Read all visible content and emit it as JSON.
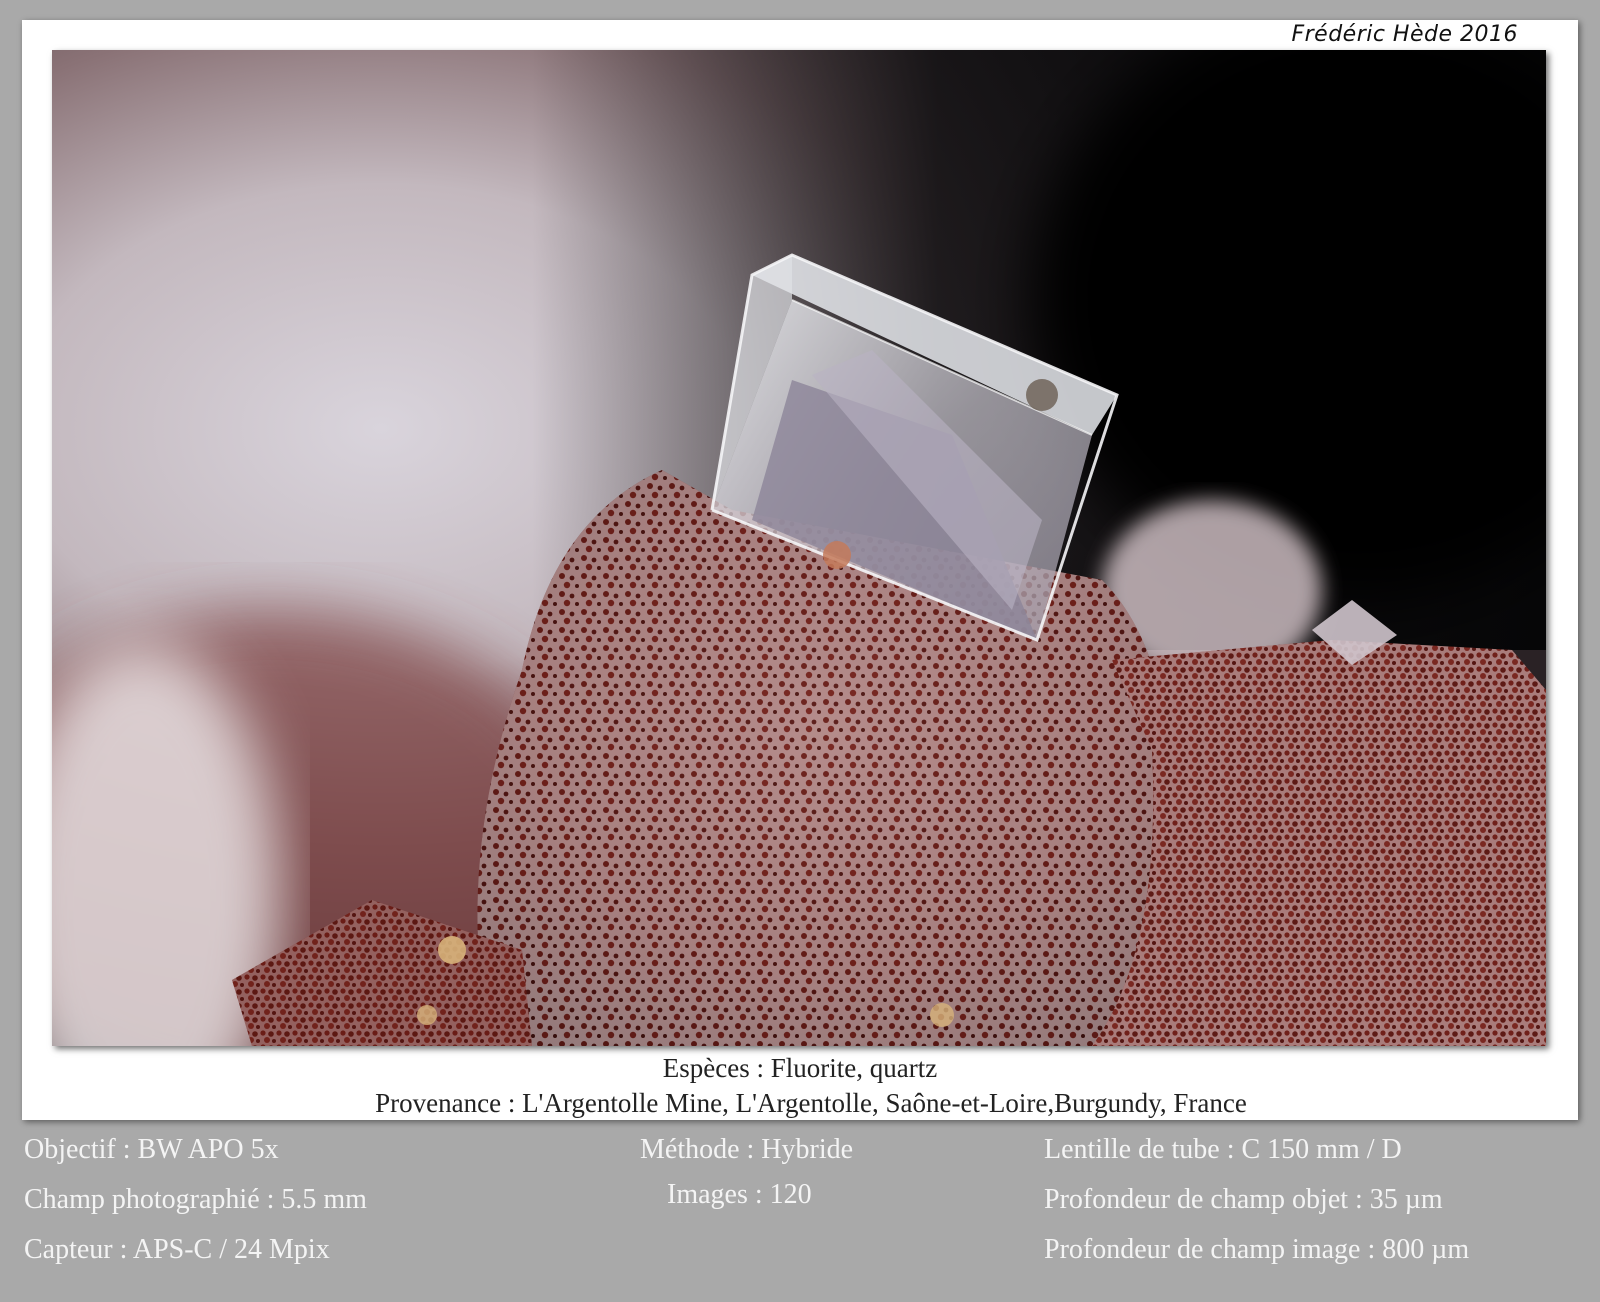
{
  "credit": "Frédéric Hède 2016",
  "caption": {
    "species": "Espèces : Fluorite, quartz",
    "provenance": "Provenance : L'Argentolle Mine, L'Argentolle, Saône-et-Loire,Burgundy, France"
  },
  "meta": {
    "left": [
      "Objectif : BW APO 5x",
      "Champ photographié : 5.5 mm",
      "Capteur : APS-C / 24 Mpix"
    ],
    "center": [
      "Méthode : Hybride",
      "Images : 120"
    ],
    "right": [
      "Lentille de tube : C 150 mm / D",
      "Profondeur de champ objet : 35 µm",
      "Profondeur de champ image : 800 µm"
    ]
  },
  "colors": {
    "background": "#a9a9a9",
    "card": "#ffffff",
    "meta_text": "#f4f4f4",
    "hematite_red": "#6e1d17",
    "backdrop_dark": "#0a0a0c"
  },
  "icons": [
    "fluorite-cube-crystal",
    "hematite-speckled-quartz"
  ]
}
